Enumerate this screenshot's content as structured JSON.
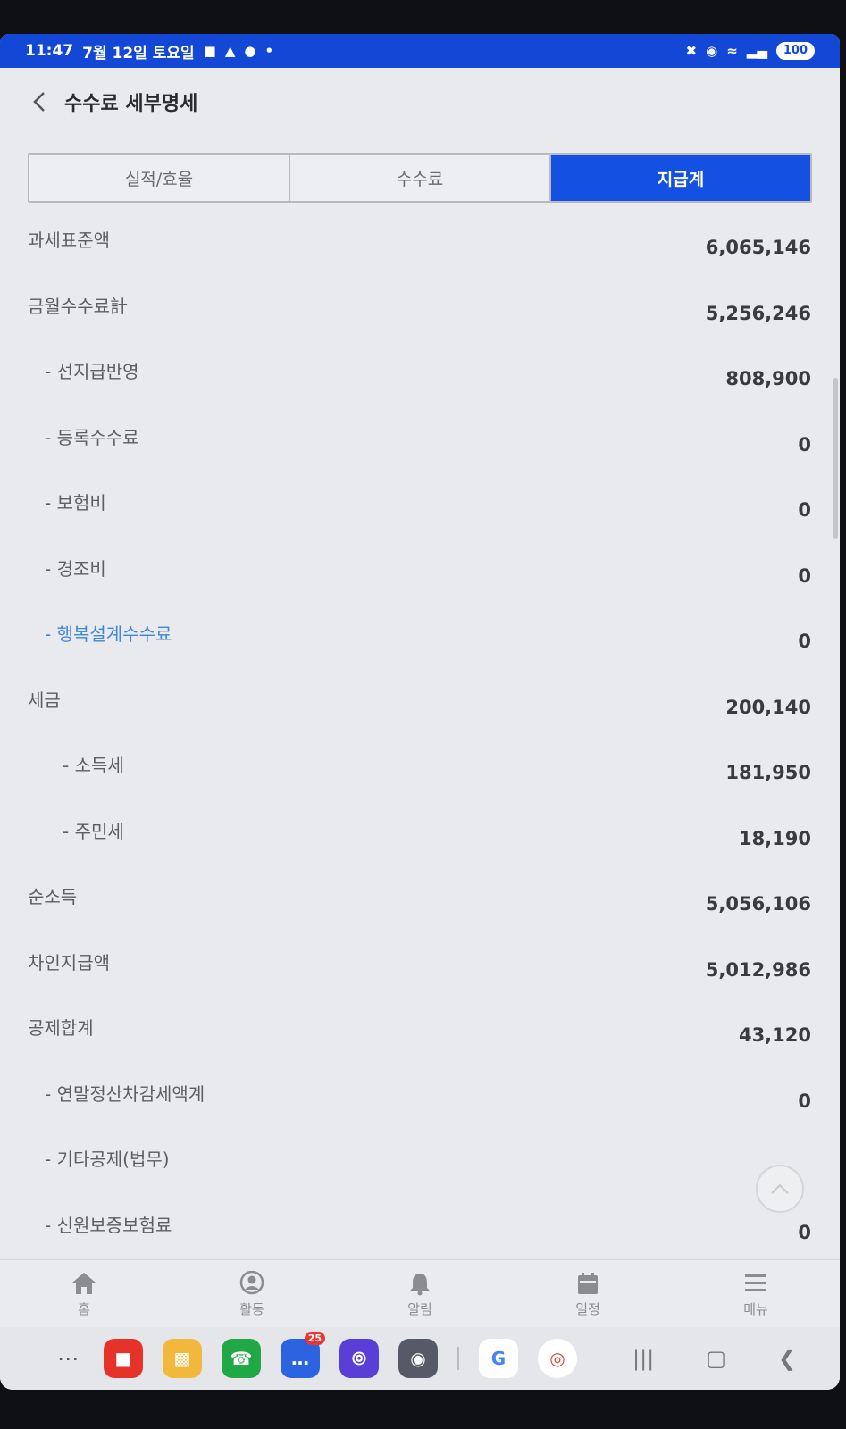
{
  "status": {
    "time": "11:47",
    "date": "7월 12일 토요일",
    "battery": "100"
  },
  "header": {
    "title": "수수료 세부명세"
  },
  "tabs": [
    {
      "label": "실적/효율",
      "active": false
    },
    {
      "label": "수수료",
      "active": false
    },
    {
      "label": "지급계",
      "active": true
    }
  ],
  "rows": [
    {
      "label": "과세표준액",
      "value": "6,065,146"
    },
    {
      "label": "금월수수료計",
      "value": "5,256,246"
    },
    {
      "label": "- 선지급반영",
      "value": "808,900"
    },
    {
      "label": "- 등록수수료",
      "value": "0"
    },
    {
      "label": "- 보험비",
      "value": "0"
    },
    {
      "label": "- 경조비",
      "value": "0"
    },
    {
      "label": "- 행복설계수수료",
      "value": "0"
    },
    {
      "label": "세금",
      "value": "200,140"
    },
    {
      "label": "- 소득세",
      "value": "181,950"
    },
    {
      "label": "- 주민세",
      "value": "18,190"
    },
    {
      "label": "순소득",
      "value": "5,056,106"
    },
    {
      "label": "차인지급액",
      "value": "5,012,986"
    },
    {
      "label": "공제합계",
      "value": "43,120"
    },
    {
      "label": "- 연말정산차감세액계",
      "value": "0"
    },
    {
      "label": "- 기타공제(법무)",
      "value": ""
    },
    {
      "label": "- 신원보증보험료",
      "value": "0"
    }
  ],
  "bottom_nav": [
    {
      "label": "홈",
      "icon": "home-icon"
    },
    {
      "label": "활동",
      "icon": "person-icon"
    },
    {
      "label": "알림",
      "icon": "bell-icon"
    },
    {
      "label": "일정",
      "icon": "calendar-icon"
    },
    {
      "label": "메뉴",
      "icon": "menu-icon"
    }
  ],
  "dock": {
    "messages_badge": "25"
  },
  "colors": {
    "status_bar": "#1347d6",
    "tab_active": "#1450e2",
    "link_text": "#3d86d8"
  }
}
